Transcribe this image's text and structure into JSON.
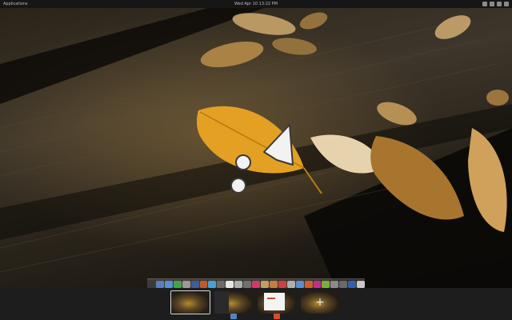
{
  "panel": {
    "applications_label": "Applications",
    "clock": "Wed Apr 10 13:22 PM",
    "tray_icons": [
      "network-icon",
      "volume-icon",
      "battery-icon",
      "user-icon"
    ]
  },
  "dock": {
    "items": [
      {
        "icon": "terminal-icon",
        "color": "#3b3b3b"
      },
      {
        "icon": "files-icon",
        "color": "#5a7fbf"
      },
      {
        "icon": "chat-icon",
        "color": "#5a8fd0"
      },
      {
        "icon": "download-icon",
        "color": "#3fa64a"
      },
      {
        "icon": "camera-icon",
        "color": "#9a9a9a"
      },
      {
        "icon": "browser-icon",
        "color": "#3c5c9a"
      },
      {
        "icon": "media-icon",
        "color": "#c05a2a"
      },
      {
        "icon": "network-icon",
        "color": "#4aa0d8"
      },
      {
        "icon": "chart-icon",
        "color": "#6a6a6a"
      },
      {
        "icon": "document-icon",
        "color": "#e6e6e6"
      },
      {
        "icon": "photo-icon",
        "color": "#b0b0b0"
      },
      {
        "icon": "monitor-icon",
        "color": "#707070"
      },
      {
        "icon": "music-icon",
        "color": "#d03a6a"
      },
      {
        "icon": "image-viewer-icon",
        "color": "#c0a060"
      },
      {
        "icon": "archive-icon",
        "color": "#c08040"
      },
      {
        "icon": "record-icon",
        "color": "#d04040"
      },
      {
        "icon": "paint-icon",
        "color": "#b0b0b0"
      },
      {
        "icon": "tools-icon",
        "color": "#5a8fd0"
      },
      {
        "icon": "store-icon",
        "color": "#d06030"
      },
      {
        "icon": "game-icon",
        "color": "#c0308a"
      },
      {
        "icon": "spreadsheet-icon",
        "color": "#7ab03a"
      },
      {
        "icon": "text-editor-icon",
        "color": "#8a8a8a"
      },
      {
        "icon": "settings-icon",
        "color": "#6a6a6a"
      },
      {
        "icon": "word-processor-icon",
        "color": "#3060b0"
      },
      {
        "icon": "trash-icon",
        "color": "#c8c8c8"
      }
    ]
  },
  "workspaces": {
    "items": [
      {
        "name": "workspace-1",
        "active": true,
        "type": "wallpaper",
        "app_icon": "",
        "app_icon_color": ""
      },
      {
        "name": "workspace-2",
        "active": false,
        "type": "wallpaper-terminal",
        "app_icon": "files-icon",
        "app_icon_color": "#5a7fbf"
      },
      {
        "name": "workspace-3",
        "active": false,
        "type": "window",
        "app_icon": "browser-icon",
        "app_icon_color": "#d05030"
      },
      {
        "name": "workspace-new",
        "active": false,
        "type": "add",
        "app_icon": "",
        "app_icon_color": ""
      }
    ],
    "add_symbol": "+"
  }
}
